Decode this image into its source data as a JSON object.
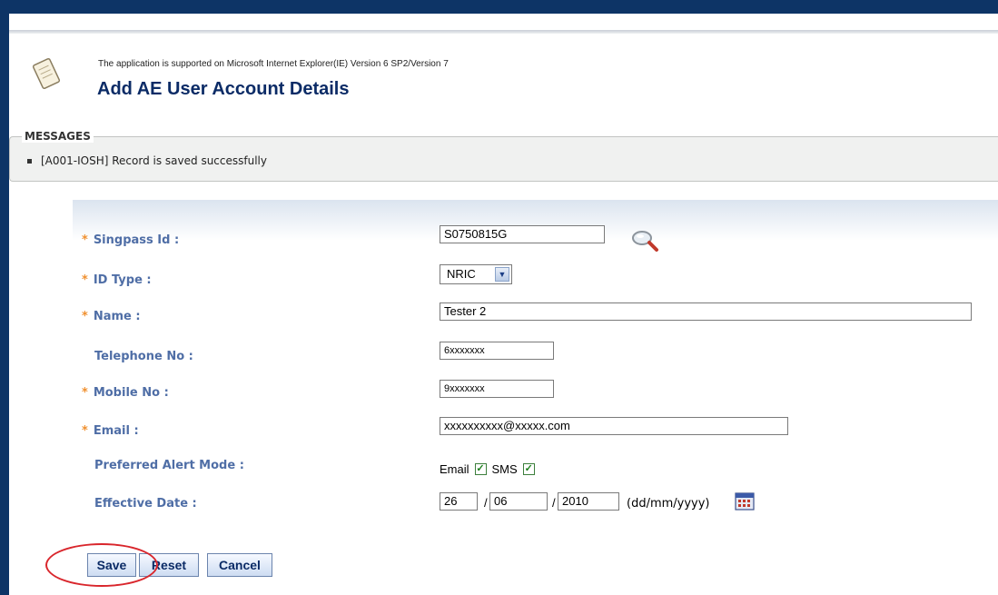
{
  "header": {
    "support_note": "The application is supported on Microsoft Internet Explorer(IE) Version 6 SP2/Version 7",
    "title": "Add AE User Account Details",
    "icon": "notepad-icon"
  },
  "messages": {
    "legend": "MESSAGES",
    "items": [
      "[A001-IOSH] Record is saved successfully"
    ]
  },
  "form": {
    "singpass_label": "Singpass Id :",
    "singpass_value": "S0750815G",
    "id_type_label": "ID Type :",
    "id_type_value": "NRIC",
    "name_label": "Name :",
    "name_value": "Tester 2",
    "telephone_label": "Telephone No :",
    "telephone_value": "6xxxxxxx",
    "mobile_label": "Mobile No :",
    "mobile_value": "9xxxxxxx",
    "email_label": "Email :",
    "email_value": "xxxxxxxxxx@xxxxx.com",
    "alert_label": "Preferred Alert Mode :",
    "alert_email_label": "Email",
    "alert_email_checked": true,
    "alert_sms_label": "SMS",
    "alert_sms_checked": true,
    "effective_label": "Effective Date :",
    "effective_day": "26",
    "effective_month": "06",
    "effective_year": "2010",
    "date_slash": "/",
    "date_format": "(dd/mm/yyyy)"
  },
  "buttons": {
    "save": "Save",
    "reset": "Reset",
    "cancel": "Cancel"
  },
  "colors": {
    "frame": "#0d3466",
    "title": "#0b2b66",
    "label": "#4f6ea6",
    "required": "#f0902f",
    "highlight": "#d9262c"
  }
}
